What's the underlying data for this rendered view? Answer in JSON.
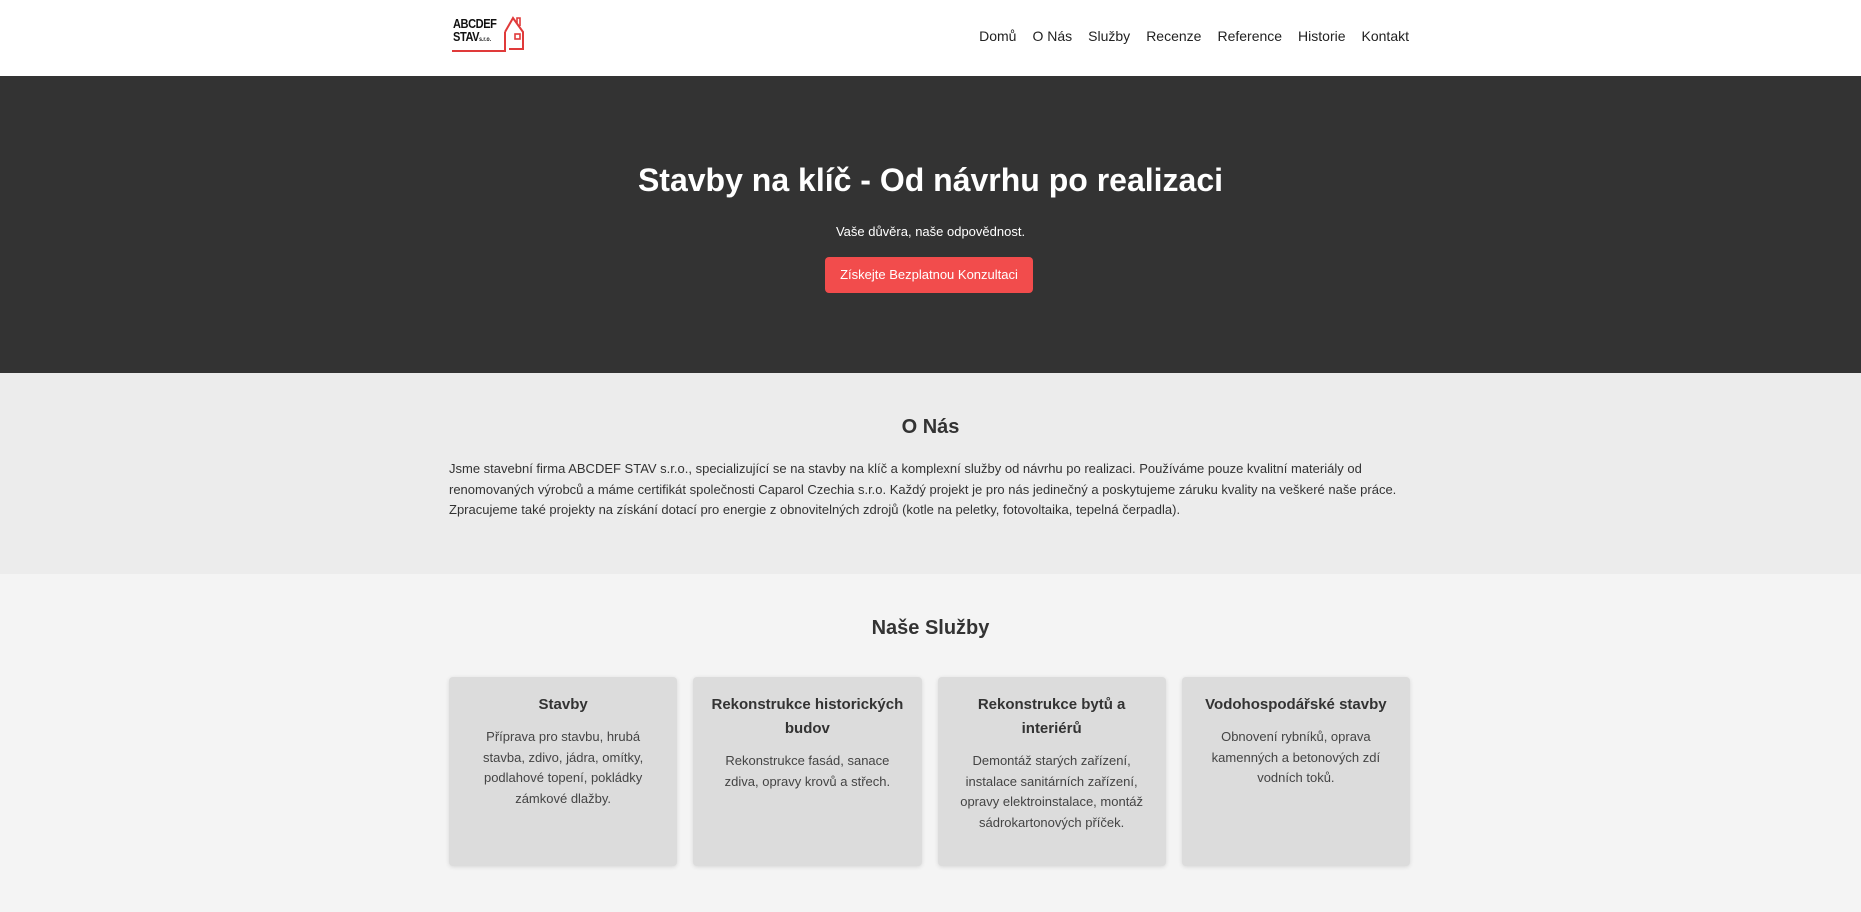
{
  "header": {
    "logo": {
      "line1": "ABCDEF",
      "line2": "STAV",
      "suffix": "s.r.o.",
      "accent": "#e03a3a"
    },
    "nav": [
      "Domů",
      "O Nás",
      "Služby",
      "Recenze",
      "Reference",
      "Historie",
      "Kontakt"
    ]
  },
  "hero": {
    "title": "Stavby na klíč - Od návrhu po realizaci",
    "subtitle": "Vaše důvěra, naše odpovědnost.",
    "cta_label": "Získejte Bezplatnou Konzultaci",
    "background": "#333333",
    "cta_color": "#f24c4c"
  },
  "about": {
    "heading": "O Nás",
    "text": "Jsme stavební firma ABCDEF STAV s.r.o., specializující se na stavby na klíč a komplexní služby od návrhu po realizaci. Používáme pouze kvalitní materiály od renomovaných výrobců a máme certifikát společnosti Caparol Czechia s.r.o. Každý projekt je pro nás jedinečný a poskytujeme záruku kvality na veškeré naše práce. Zpracujeme také projekty na získání dotací pro energie z obnovitelných zdrojů (kotle na peletky, fotovoltaika, tepelná čerpadla)."
  },
  "services": {
    "heading": "Naše Služby",
    "items": [
      {
        "title": "Stavby",
        "text": "Příprava pro stavbu, hrubá stavba, zdivo, jádra, omítky, podlahové topení, pokládky zámkové dlažby."
      },
      {
        "title": "Rekonstrukce historických budov",
        "text": "Rekonstrukce fasád, sanace zdiva, opravy krovů a střech."
      },
      {
        "title": "Rekonstrukce bytů a interiérů",
        "text": "Demontáž starých zařízení, instalace sanitárních zařízení, opravy elektroinstalace, montáž sádrokartonových příček."
      },
      {
        "title": "Vodohospodářské stavby",
        "text": "Obnovení rybníků, oprava kamenných a betonových zdí vodních toků."
      }
    ]
  }
}
